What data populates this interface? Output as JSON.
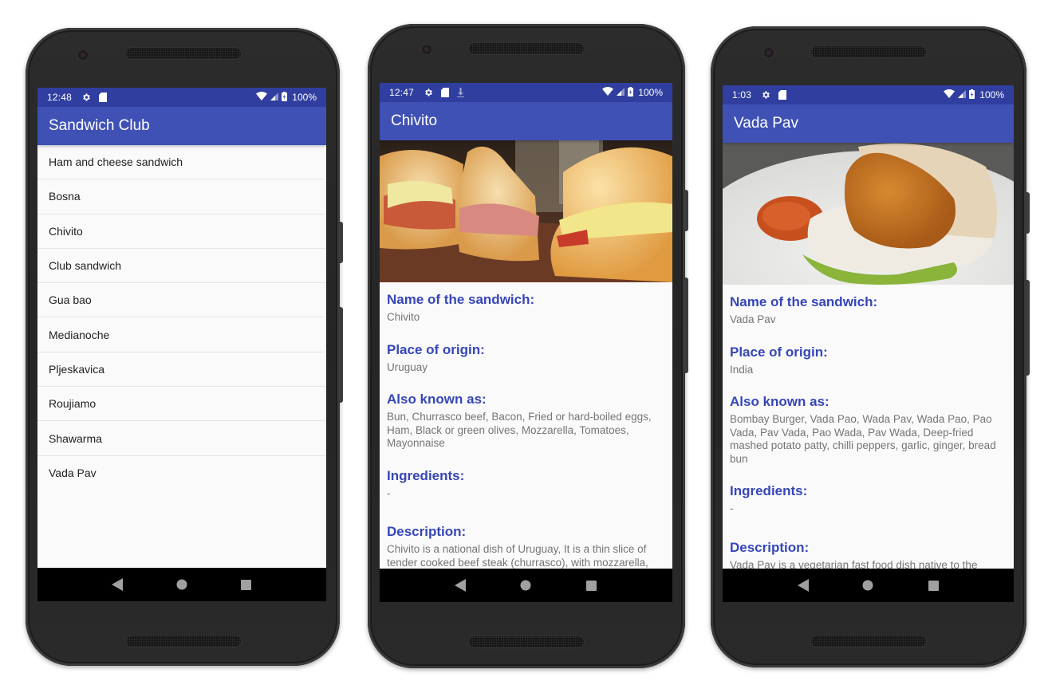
{
  "colors": {
    "status_bar": "#303f9f",
    "app_bar": "#3f51b5",
    "label": "#3646b8",
    "value_text": "#757575",
    "list_text": "#222222",
    "background": "#fafafa",
    "nav_bar": "#000000",
    "nav_icon": "#a0a0a0"
  },
  "phones": [
    {
      "status": {
        "time": "12:48",
        "icons": [
          "settings-icon",
          "sd-card-icon"
        ],
        "battery": "100%"
      },
      "app_bar": {
        "title": "Sandwich Club"
      },
      "list": [
        "Ham and cheese sandwich",
        "Bosna",
        "Chivito",
        "Club sandwich",
        "Gua bao",
        "Medianoche",
        "Pljeskavica",
        "Roujiamo",
        "Shawarma",
        "Vada Pav"
      ]
    },
    {
      "status": {
        "time": "12:47",
        "icons": [
          "settings-icon",
          "sd-card-icon",
          "download-icon"
        ],
        "battery": "100%"
      },
      "app_bar": {
        "title": "Chivito"
      },
      "image": "chivito-photo",
      "details": [
        {
          "label": "Name of the sandwich:",
          "value": "Chivito"
        },
        {
          "label": "Place of origin:",
          "value": "Uruguay"
        },
        {
          "label": "Also known as:",
          "value": "Bun, Churrasco beef, Bacon, Fried or hard-boiled eggs, Ham, Black or green olives, Mozzarella, Tomatoes, Mayonnaise"
        },
        {
          "label": "Ingredients:",
          "value": "-"
        },
        {
          "label": "Description:",
          "value": "Chivito is a national dish of Uruguay, It is a thin slice of tender cooked beef steak (churrasco), with mozzarella, tomatoes, mayonnaise, black or green"
        }
      ]
    },
    {
      "status": {
        "time": "1:03",
        "icons": [
          "settings-icon",
          "sd-card-icon"
        ],
        "battery": "100%"
      },
      "app_bar": {
        "title": "Vada Pav"
      },
      "image": "vada-pav-photo",
      "details": [
        {
          "label": "Name of the sandwich:",
          "value": "Vada Pav"
        },
        {
          "label": "Place of origin:",
          "value": "India"
        },
        {
          "label": "Also known as:",
          "value": "Bombay Burger, Vada Pao, Wada Pav, Wada Pao, Pao Vada, Pav Vada, Pao Wada, Pav Wada, Deep-fried mashed potato patty, chilli peppers, garlic, ginger, bread bun"
        },
        {
          "label": "Ingredients:",
          "value": "-"
        },
        {
          "label": "Description:",
          "value": "Vada Pav is a vegetarian fast food dish native to the Indian state of Maharashtra. The dish consists of"
        }
      ]
    }
  ],
  "nav": {
    "buttons": [
      "back",
      "home",
      "recents"
    ]
  }
}
